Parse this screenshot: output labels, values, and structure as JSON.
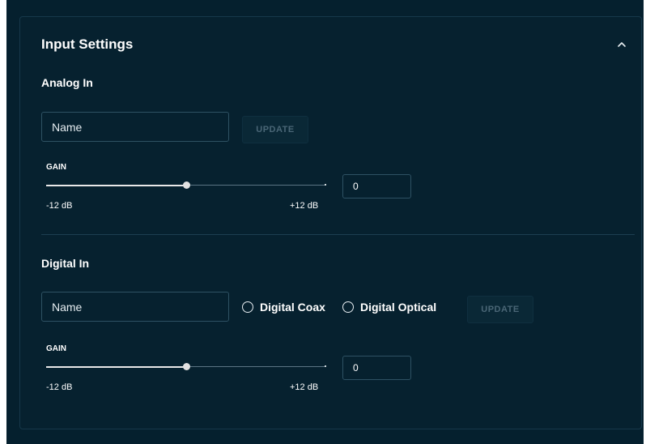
{
  "card": {
    "title": "Input Settings",
    "collapse_icon": "chevron-up-icon"
  },
  "analog": {
    "title": "Analog In",
    "name_placeholder": "Name",
    "update_label": "UPDATE",
    "gain": {
      "label": "GAIN",
      "min_label": "-12 dB",
      "max_label": "+12 dB",
      "value": "0",
      "level_fraction": 0.5
    }
  },
  "digital": {
    "title": "Digital In",
    "name_placeholder": "Name",
    "update_label": "UPDATE",
    "options": [
      {
        "label": "Digital Coax",
        "selected": false
      },
      {
        "label": "Digital Optical",
        "selected": false
      }
    ],
    "gain": {
      "label": "GAIN",
      "min_label": "-12 dB",
      "max_label": "+12 dB",
      "value": "0",
      "level_fraction": 0.5
    }
  },
  "colors": {
    "background": "#05202e",
    "text": "#ffffff",
    "border": "#2e5163",
    "disabled_text": "#4a6676"
  }
}
